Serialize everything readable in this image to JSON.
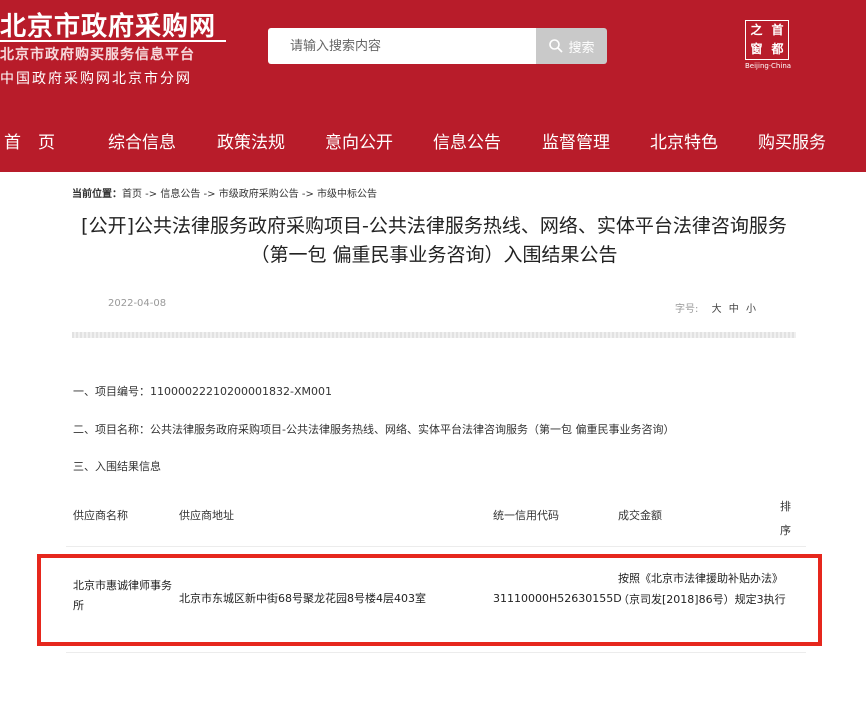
{
  "header": {
    "logo_main": "北京市政府采购网",
    "logo_sub": "北京市政府购买服务信息平台",
    "logo_sub2": "中国政府采购网北京市分网",
    "search": {
      "placeholder": "请输入搜索内容",
      "button_label": "搜索"
    },
    "emblem": {
      "chars": [
        "首",
        "都",
        "之",
        "窗"
      ],
      "caption": "Beijing·China"
    }
  },
  "nav": {
    "items": [
      "首　页",
      "综合信息",
      "政策法规",
      "意向公开",
      "信息公告",
      "监督管理",
      "北京特色",
      "购买服务"
    ]
  },
  "breadcrumb": {
    "label": "当前位置：",
    "path": "首页 -> 信息公告 -> 市级政府采购公告 -> 市级中标公告"
  },
  "article": {
    "title": "[公开]公共法律服务政府采购项目-公共法律服务热线、网络、实体平台法律咨询服务（第一包 偏重民事业务咨询）入围结果公告",
    "date": "2022-04-08",
    "fontsize_label": "字号:",
    "fontsize_options": [
      "大",
      "中",
      "小"
    ],
    "p1": "一、项目编号：11000022210200001832-XM001",
    "p2": "二、项目名称：公共法律服务政府采购项目-公共法律服务热线、网络、实体平台法律咨询服务（第一包 偏重民事业务咨询）",
    "p3": "三、入围结果信息"
  },
  "table": {
    "headers": [
      "供应商名称",
      "供应商地址",
      "统一信用代码",
      "成交金额",
      "排序"
    ],
    "rows": [
      {
        "name": "北京市惠诚律师事务所",
        "address": "北京市东城区新中街68号聚龙花园8号楼4层403室",
        "credit_code": "31110000H52630155D",
        "amount": "按照《北京市法律援助补贴办法》（京司发[2018]86号）规定3执行"
      }
    ]
  },
  "colors": {
    "brand": "#b81c2a",
    "highlight": "#e6271d"
  }
}
